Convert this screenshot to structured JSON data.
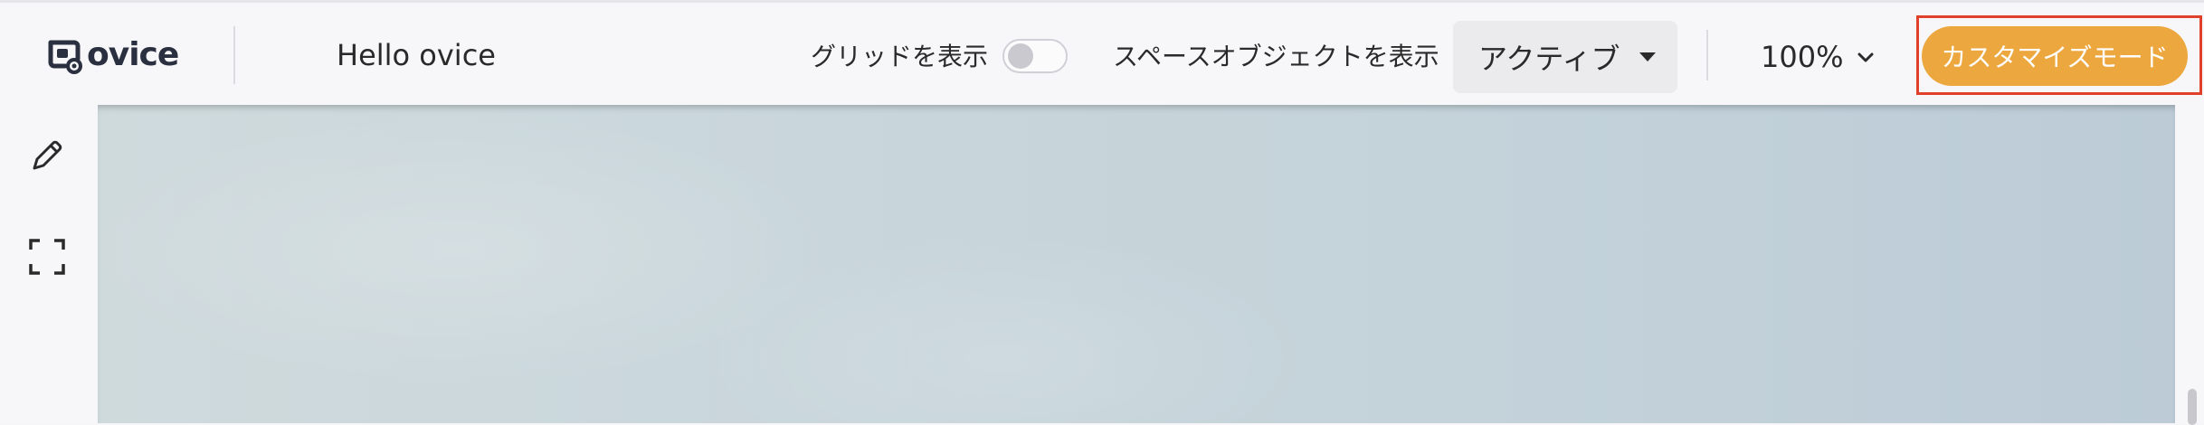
{
  "app": {
    "logo_text": "ovice",
    "workspace_name": "Hello ovice"
  },
  "toolbar": {
    "grid_label": "グリッドを表示",
    "grid_toggle_on": false,
    "space_objects_label": "スペースオブジェクトを表示",
    "status_selected": "アクティブ",
    "zoom_level": "100%",
    "customize_label": "カスタマイズモード"
  },
  "side_rail": {
    "items": [
      {
        "icon": "pencil-icon"
      },
      {
        "icon": "fullscreen-icon"
      }
    ]
  },
  "colors": {
    "accent": "#eca73e",
    "highlight": "#e0412d",
    "canvas": "#c7d4da"
  }
}
